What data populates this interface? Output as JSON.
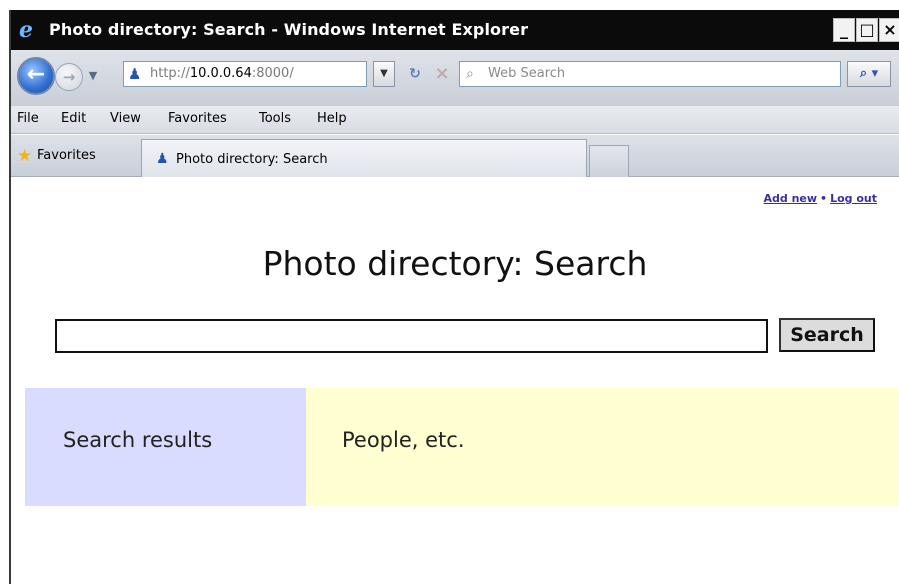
{
  "window": {
    "title": "Photo directory: Search - Windows Internet Explorer",
    "controls": {
      "minimize": "_",
      "maximize": "□",
      "close": "×"
    }
  },
  "addressbar": {
    "url_prefix": "http://",
    "url_host": "10.0.0.64",
    "url_suffix": ":8000/",
    "search_placeholder": "Web Search"
  },
  "menu": {
    "items": [
      "File",
      "Edit",
      "View",
      "Favorites",
      "Tools",
      "Help"
    ]
  },
  "favorites": {
    "label": "Favorites",
    "tab_label": "Photo directory: Search"
  },
  "page": {
    "links": {
      "add_new": "Add new",
      "separator": "•",
      "log_out": "Log out"
    },
    "title": "Photo directory: Search",
    "search": {
      "value": "",
      "button_label": "Search"
    },
    "panels": {
      "results_label": "Search results",
      "people_label": "People, etc."
    }
  },
  "colors": {
    "results_panel_bg": "#dadcff",
    "people_panel_bg": "#ffffd2",
    "link": "#3c2fa6",
    "titlebar": "#0b0b0b"
  },
  "icons": {
    "browser": "ie-logo-icon",
    "back": "back-arrow-icon",
    "forward": "forward-arrow-icon",
    "site": "person-icon",
    "refresh": "refresh-icon",
    "stop": "stop-icon",
    "search": "magnifier-icon",
    "favorites": "star-icon"
  }
}
